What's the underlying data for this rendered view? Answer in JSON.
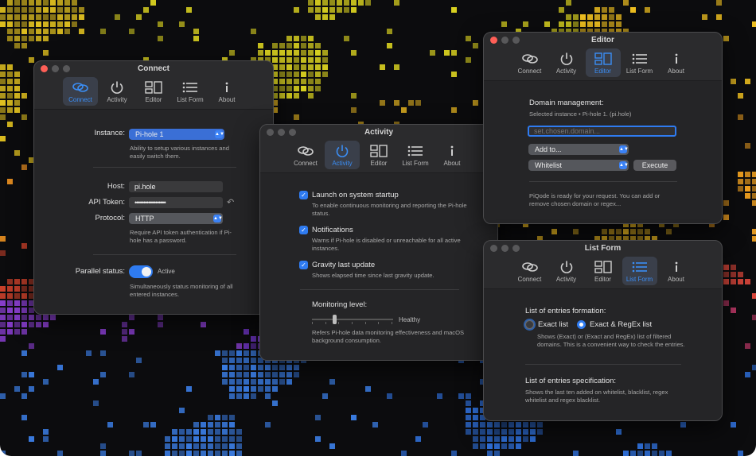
{
  "colors": {
    "accent": "#2f7bf0",
    "window_bg": "#252527",
    "close": "#ff5f57"
  },
  "tabs": [
    {
      "label": "Connect",
      "icon": "connect-link-icon"
    },
    {
      "label": "Activity",
      "icon": "power-icon"
    },
    {
      "label": "Editor",
      "icon": "editor-layout-icon"
    },
    {
      "label": "List Form",
      "icon": "list-icon"
    },
    {
      "label": "About",
      "icon": "info-icon"
    }
  ],
  "connect": {
    "title": "Connect",
    "instance_label": "Instance:",
    "instance_value": "Pi-hole 1",
    "instance_help": "Ability to setup various instances and easily switch them.",
    "host_label": "Host:",
    "host_value": "pi.hole",
    "token_label": "API Token:",
    "token_value": "••••••••••••••••••",
    "protocol_label": "Protocol:",
    "protocol_value": "HTTP",
    "protocol_help": "Require API token authentication if Pi-hole has a password.",
    "parallel_label": "Parallel status:",
    "parallel_state": "Active",
    "parallel_help": "Simultaneously status monitoring of all entered instances."
  },
  "activity": {
    "title": "Activity",
    "launch_label": "Launch on system startup",
    "launch_help": "To enable continuous monitoring and reporting the Pi-hole status.",
    "notif_label": "Notifications",
    "notif_help": "Warns if Pi-hole is disabled or unreachable for all active instances.",
    "gravity_label": "Gravity last update",
    "gravity_help": "Shows elapsed time since last gravity update.",
    "monitor_label": "Monitoring level:",
    "monitor_value_label": "Healthy",
    "monitor_level": 0.28,
    "monitor_help": "Refers Pi-hole data monitoring effectiveness and macOS background consumption."
  },
  "editor": {
    "title": "Editor",
    "heading": "Domain management:",
    "selected": "Selected instance • Pi-hole 1. (pi.hole)",
    "domain_placeholder": "set.chosen.domain...",
    "add_to": "Add to...",
    "list_value": "Whitelist",
    "execute": "Execute",
    "status": "PiQode is ready for your request. You can add or remove chosen domain or regex..."
  },
  "listform": {
    "title": "List Form",
    "formation_heading": "List of entries formation:",
    "opt_exact": "Exact list",
    "opt_regex": "Exact & RegEx list",
    "formation_help": "Shows (Exact) or (Exact and RegEx) list of filtered domains. This is a convenient way to check the entries.",
    "spec_heading": "List of entries specification:",
    "spec_help": "Shows the last ten added on whitelist, blacklist, regex whitelist and regex blacklist."
  }
}
